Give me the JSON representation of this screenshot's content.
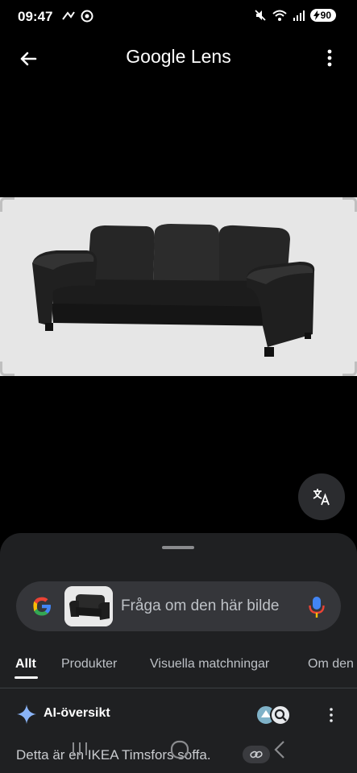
{
  "status": {
    "time": "09:47",
    "battery": "90"
  },
  "app": {
    "title_google": "Google",
    "title_lens": "Lens"
  },
  "search": {
    "placeholder": "Fråga om den här bilde"
  },
  "tabs": [
    {
      "label": "Allt",
      "active": true
    },
    {
      "label": "Produkter",
      "active": false
    },
    {
      "label": "Visuella matchningar",
      "active": false
    },
    {
      "label": "Om den",
      "active": false
    }
  ],
  "ai_overview": {
    "title": "AI-översikt",
    "text": "Detta är en IKEA Timsfors soffa."
  },
  "icons": {
    "back": "arrow-back-icon",
    "more": "more-vert-icon",
    "translate": "translate-icon",
    "mic": "mic-icon",
    "google": "google-g-icon",
    "ai": "sparkle-icon",
    "link": "link-icon"
  },
  "colors": {
    "background": "#000000",
    "sheet": "#1f2022",
    "pill": "#35363a",
    "mic_blue": "#4285f4",
    "mic_red": "#ea4335",
    "ai_blue": "#8ab4f8"
  }
}
